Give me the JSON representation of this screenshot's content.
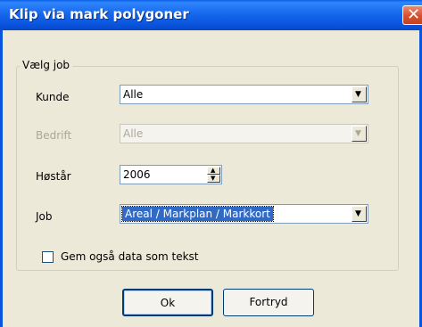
{
  "window": {
    "title": "Klip via mark polygoner"
  },
  "group": {
    "legend": "Vælg job"
  },
  "fields": {
    "kunde": {
      "label": "Kunde",
      "value": "Alle"
    },
    "bedrift": {
      "label": "Bedrift",
      "value": "Alle",
      "disabled": true
    },
    "hostar": {
      "label": "Høstår",
      "value": "2006"
    },
    "job": {
      "label": "Job",
      "value": "Areal / Markplan / Markkort"
    }
  },
  "checkbox": {
    "label": "Gem også data som tekst",
    "checked": false
  },
  "buttons": {
    "ok": "Ok",
    "cancel": "Fortryd"
  },
  "icons": {
    "close": "close-icon",
    "dropdown": "chevron-down-icon",
    "spin_up": "arrow-up-icon",
    "spin_down": "arrow-down-icon"
  },
  "colors": {
    "titlebar": "#0a5ee8",
    "dialog_bg": "#ece9d8",
    "selection": "#316ac5",
    "close_button": "#d4502e"
  }
}
